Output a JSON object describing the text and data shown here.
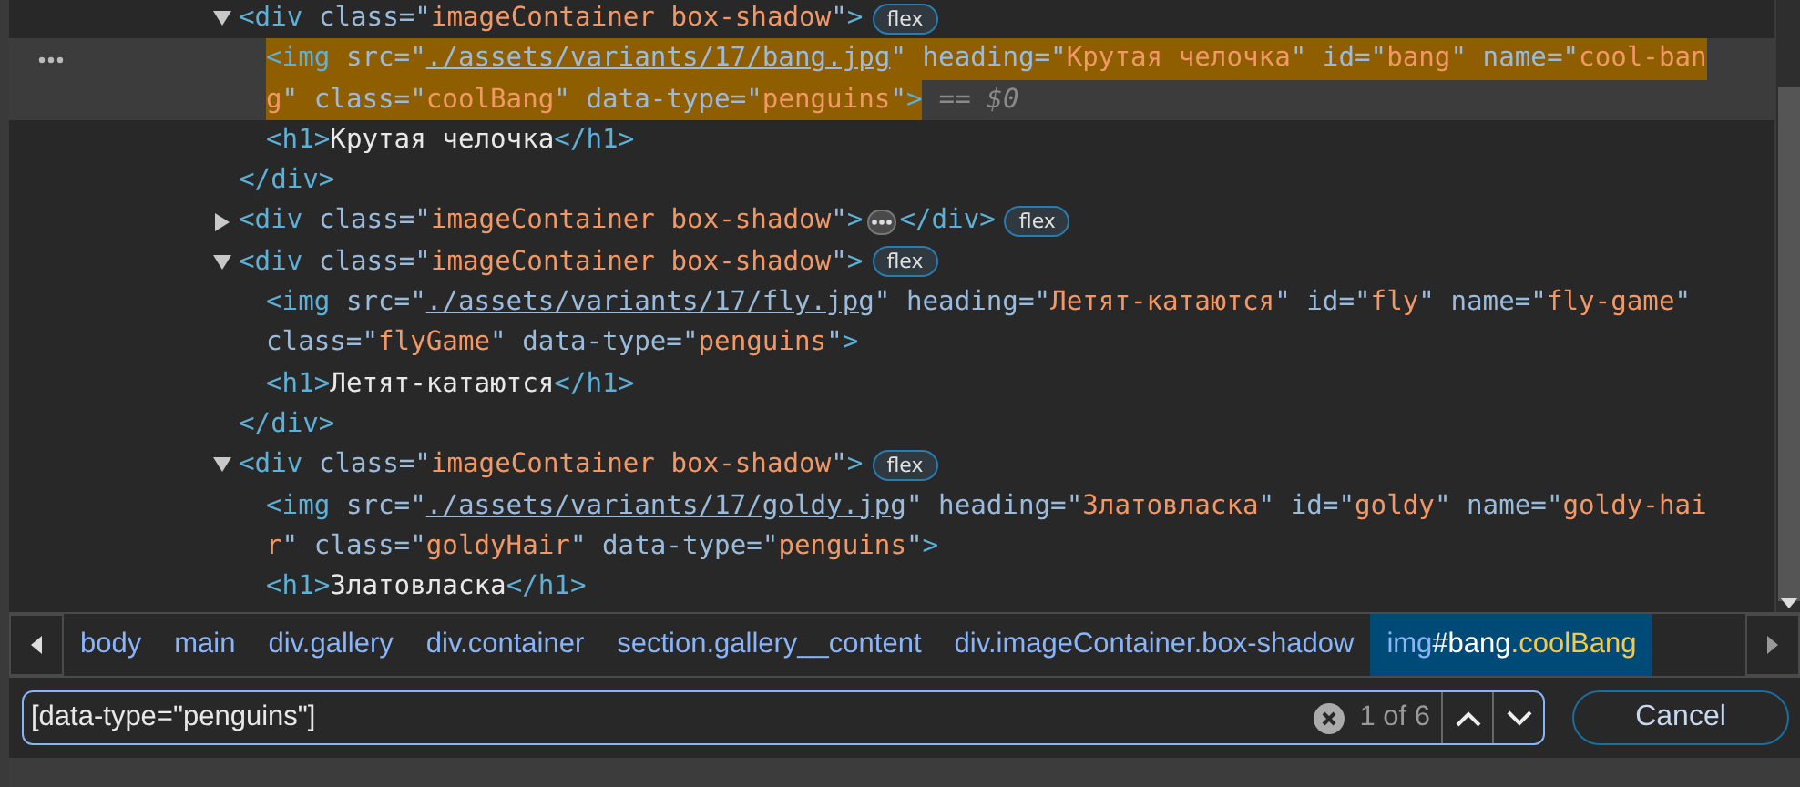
{
  "tree": [
    {
      "kind": "container",
      "expanded": true,
      "selected": false,
      "badge": "flex",
      "lines": [
        [
          {
            "kind": "tag",
            "text": "<div"
          },
          {
            "kind": "attr",
            "text": " class=\""
          },
          {
            "kind": "val",
            "text": "imageContainer box-shadow"
          },
          {
            "kind": "attr",
            "text": "\""
          },
          {
            "kind": "tag",
            "text": ">"
          }
        ]
      ],
      "closing": [
        {
          "kind": "tag",
          "text": "</div>"
        }
      ],
      "children": [
        {
          "kind": "leaf",
          "selected": true,
          "console_ref": "== $0",
          "lines": [
            [
              {
                "kind": "tag",
                "text": "<img"
              },
              {
                "kind": "attr",
                "text": " src=\""
              },
              {
                "kind": "link",
                "text": "./assets/variants/17/bang.jpg"
              },
              {
                "kind": "attr",
                "text": "\" heading=\""
              },
              {
                "kind": "val",
                "text": "Крутая челочка"
              },
              {
                "kind": "attr",
                "text": "\" id=\""
              },
              {
                "kind": "val",
                "text": "bang"
              },
              {
                "kind": "attr",
                "text": "\" name=\""
              },
              {
                "kind": "val",
                "text": "cool-ban"
              }
            ],
            [
              {
                "kind": "val",
                "text": "g"
              },
              {
                "kind": "attr",
                "text": "\" class=\""
              },
              {
                "kind": "val",
                "text": "coolBang"
              },
              {
                "kind": "attr",
                "text": "\" data-type=\""
              },
              {
                "kind": "val",
                "text": "penguins"
              },
              {
                "kind": "attr",
                "text": "\""
              },
              {
                "kind": "tag",
                "text": ">"
              }
            ]
          ]
        },
        {
          "kind": "leaf",
          "selected": false,
          "lines": [
            [
              {
                "kind": "tag",
                "text": "<h1>"
              },
              {
                "kind": "text",
                "text": "Крутая челочка"
              },
              {
                "kind": "tag",
                "text": "</h1>"
              }
            ]
          ]
        }
      ]
    },
    {
      "kind": "container",
      "expanded": false,
      "selected": false,
      "badge": "flex",
      "lines": [
        [
          {
            "kind": "tag",
            "text": "<div"
          },
          {
            "kind": "attr",
            "text": " class=\""
          },
          {
            "kind": "val",
            "text": "imageContainer box-shadow"
          },
          {
            "kind": "attr",
            "text": "\""
          },
          {
            "kind": "tag",
            "text": ">"
          }
        ]
      ],
      "closing": [
        {
          "kind": "tag",
          "text": "</div>"
        }
      ]
    },
    {
      "kind": "container",
      "expanded": true,
      "selected": false,
      "badge": "flex",
      "lines": [
        [
          {
            "kind": "tag",
            "text": "<div"
          },
          {
            "kind": "attr",
            "text": " class=\""
          },
          {
            "kind": "val",
            "text": "imageContainer box-shadow"
          },
          {
            "kind": "attr",
            "text": "\""
          },
          {
            "kind": "tag",
            "text": ">"
          }
        ]
      ],
      "closing": [
        {
          "kind": "tag",
          "text": "</div>"
        }
      ],
      "children": [
        {
          "kind": "leaf",
          "selected": false,
          "lines": [
            [
              {
                "kind": "tag",
                "text": "<img"
              },
              {
                "kind": "attr",
                "text": " src=\""
              },
              {
                "kind": "link",
                "text": "./assets/variants/17/fly.jpg"
              },
              {
                "kind": "attr",
                "text": "\" heading=\""
              },
              {
                "kind": "val",
                "text": "Летят-катаются"
              },
              {
                "kind": "attr",
                "text": "\" id=\""
              },
              {
                "kind": "val",
                "text": "fly"
              },
              {
                "kind": "attr",
                "text": "\" name=\""
              },
              {
                "kind": "val",
                "text": "fly-game"
              },
              {
                "kind": "attr",
                "text": "\""
              }
            ],
            [
              {
                "kind": "attr",
                "text": "class=\""
              },
              {
                "kind": "val",
                "text": "flyGame"
              },
              {
                "kind": "attr",
                "text": "\" data-type=\""
              },
              {
                "kind": "val",
                "text": "penguins"
              },
              {
                "kind": "attr",
                "text": "\""
              },
              {
                "kind": "tag",
                "text": ">"
              }
            ]
          ]
        },
        {
          "kind": "leaf",
          "selected": false,
          "lines": [
            [
              {
                "kind": "tag",
                "text": "<h1>"
              },
              {
                "kind": "text",
                "text": "Летят-катаются"
              },
              {
                "kind": "tag",
                "text": "</h1>"
              }
            ]
          ]
        }
      ]
    },
    {
      "kind": "container",
      "expanded": true,
      "selected": false,
      "badge": "flex",
      "lines": [
        [
          {
            "kind": "tag",
            "text": "<div"
          },
          {
            "kind": "attr",
            "text": " class=\""
          },
          {
            "kind": "val",
            "text": "imageContainer box-shadow"
          },
          {
            "kind": "attr",
            "text": "\""
          },
          {
            "kind": "tag",
            "text": ">"
          }
        ]
      ],
      "children": [
        {
          "kind": "leaf",
          "selected": false,
          "lines": [
            [
              {
                "kind": "tag",
                "text": "<img"
              },
              {
                "kind": "attr",
                "text": " src=\""
              },
              {
                "kind": "link",
                "text": "./assets/variants/17/goldy.jpg"
              },
              {
                "kind": "attr",
                "text": "\" heading=\""
              },
              {
                "kind": "val",
                "text": "Златовласка"
              },
              {
                "kind": "attr",
                "text": "\" id=\""
              },
              {
                "kind": "val",
                "text": "goldy"
              },
              {
                "kind": "attr",
                "text": "\" name=\""
              },
              {
                "kind": "val",
                "text": "goldy-hai"
              }
            ],
            [
              {
                "kind": "val",
                "text": "r"
              },
              {
                "kind": "attr",
                "text": "\" class=\""
              },
              {
                "kind": "val",
                "text": "goldyHair"
              },
              {
                "kind": "attr",
                "text": "\" data-type=\""
              },
              {
                "kind": "val",
                "text": "penguins"
              },
              {
                "kind": "attr",
                "text": "\""
              },
              {
                "kind": "tag",
                "text": ">"
              }
            ]
          ]
        },
        {
          "kind": "leaf",
          "selected": false,
          "lines": [
            [
              {
                "kind": "tag",
                "text": "<h1>"
              },
              {
                "kind": "text",
                "text": "Златовласка"
              },
              {
                "kind": "tag",
                "text": "</h1>"
              }
            ]
          ]
        }
      ]
    }
  ],
  "breadcrumbs": [
    {
      "selected": false,
      "parts": [
        {
          "kind": "tag",
          "text": "body"
        }
      ]
    },
    {
      "selected": false,
      "parts": [
        {
          "kind": "tag",
          "text": "main"
        }
      ]
    },
    {
      "selected": false,
      "parts": [
        {
          "kind": "tag",
          "text": "div.gallery"
        }
      ]
    },
    {
      "selected": false,
      "parts": [
        {
          "kind": "tag",
          "text": "div.container"
        }
      ]
    },
    {
      "selected": false,
      "parts": [
        {
          "kind": "tag",
          "text": "section.gallery__content"
        }
      ]
    },
    {
      "selected": false,
      "parts": [
        {
          "kind": "tag",
          "text": "div.imageContainer.box-shadow"
        }
      ]
    },
    {
      "selected": true,
      "parts": [
        {
          "kind": "tag",
          "text": "img"
        },
        {
          "kind": "id",
          "text": "#bang"
        },
        {
          "kind": "class",
          "text": ".coolBang"
        }
      ]
    }
  ],
  "search": {
    "value": "[data-type=\"penguins\"]",
    "count": "1 of 6"
  },
  "cancel_button": "Cancel"
}
